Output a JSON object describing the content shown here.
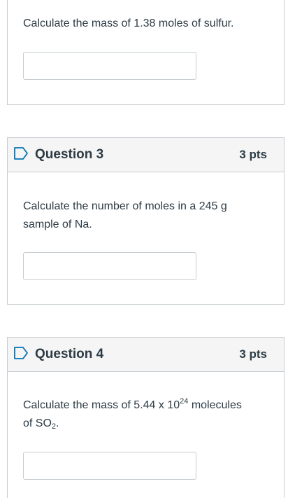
{
  "q2": {
    "text": "Calculate the mass of 1.38 moles of sulfur."
  },
  "q3": {
    "title": "Question 3",
    "points": "3 pts",
    "text_line1": "Calculate the number of moles in a 245 g",
    "text_line2": "sample of Na."
  },
  "q4": {
    "title": "Question 4",
    "points": "3 pts",
    "text_pre": "Calculate the mass of 5.44 x 10",
    "text_exp": "24",
    "text_mid": " molecules",
    "text_line2_pre": "of SO",
    "text_sub": "2",
    "text_post": "."
  },
  "colors": {
    "border": "#c7cdd1",
    "header_bg": "#f5f5f5",
    "flag": "#0374b5",
    "text": "#2d3b45"
  },
  "icons": {
    "flag": "flag-icon"
  }
}
